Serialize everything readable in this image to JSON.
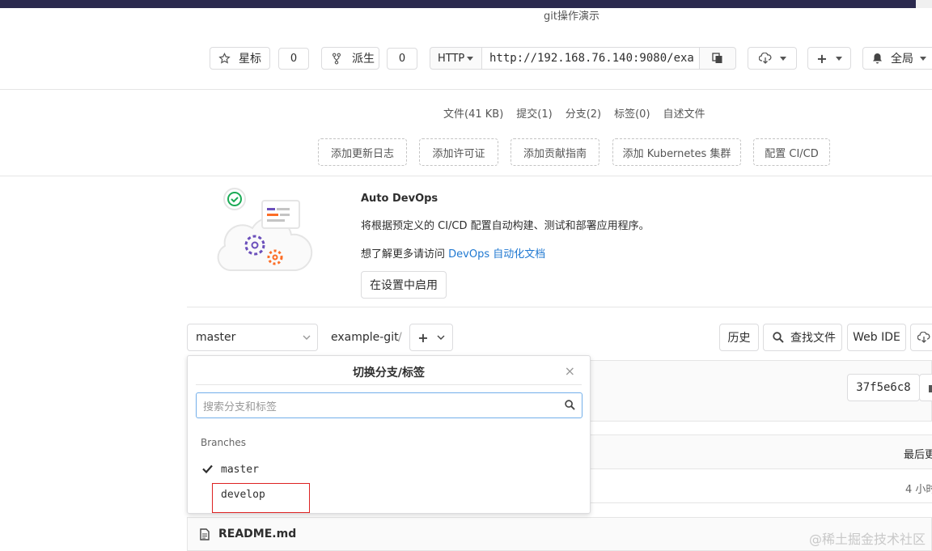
{
  "project": {
    "description": "git操作演示"
  },
  "actions": {
    "star_label": "星标",
    "star_count": "0",
    "fork_label": "派生",
    "fork_count": "0",
    "clone_protocol": "HTTP",
    "clone_url": "http://192.168.76.140:9080/exa",
    "notifications_label": "全局"
  },
  "stats": [
    {
      "label": "文件(41 KB)"
    },
    {
      "label": "提交(1)"
    },
    {
      "label": "分支(2)"
    },
    {
      "label": "标签(0)"
    },
    {
      "label": "自述文件"
    }
  ],
  "quick_links": [
    {
      "label": "添加更新日志"
    },
    {
      "label": "添加许可证"
    },
    {
      "label": "添加贡献指南"
    },
    {
      "label": "添加 Kubernetes 集群"
    },
    {
      "label": "配置 CI/CD"
    }
  ],
  "devops": {
    "title": "Auto DevOps",
    "text": "将根据预定义的 CI/CD 配置自动构建、测试和部署应用程序。",
    "learn_prefix": "想了解更多请访问 ",
    "learn_link": "DevOps 自动化文档",
    "enable_button": "在设置中启用"
  },
  "repo_nav": {
    "branch": "master",
    "project_path": "example-git",
    "separator": "/",
    "history_label": "历史",
    "find_file_label": "查找文件",
    "web_ide_label": "Web IDE"
  },
  "commit": {
    "sha": "37f5e6c8"
  },
  "table": {
    "last_update_header": "最后更",
    "time_ago": "4 小时"
  },
  "branch_dropdown": {
    "title": "切换分支/标签",
    "close": "×",
    "search_placeholder": "搜索分支和标签",
    "section_label": "Branches",
    "branches": [
      {
        "name": "master",
        "checked": true
      },
      {
        "name": "develop",
        "checked": false
      }
    ]
  },
  "readme": {
    "filename": "README.md"
  },
  "watermark": "@稀土掘金技术社区",
  "colors": {
    "link": "#1f78d1",
    "highlight_border": "#dd2222",
    "search_focus": "#73afea"
  }
}
